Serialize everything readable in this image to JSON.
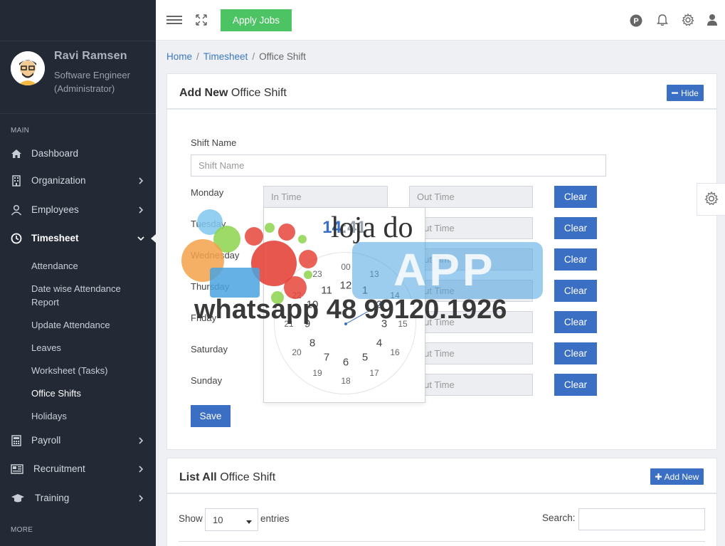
{
  "topbar": {
    "apply_label": "Apply Jobs",
    "icons": [
      "menu-icon",
      "fullscreen-icon",
      "p-badge-icon",
      "bell-icon",
      "gear-icon",
      "user-icon"
    ]
  },
  "sidebar": {
    "user": {
      "name": "Ravi Ramsen",
      "role_line1": "Software Engineer",
      "role_line2": "(Administrator)"
    },
    "main_label": "MAIN",
    "more_label": "MORE",
    "items": [
      {
        "label": "Dashboard",
        "icon": "home-icon"
      },
      {
        "label": "Organization",
        "icon": "building-icon"
      },
      {
        "label": "Employees",
        "icon": "user-icon"
      },
      {
        "label": "Timesheet",
        "icon": "clock-icon"
      },
      {
        "label": "Payroll",
        "icon": "calculator-icon"
      },
      {
        "label": "Recruitment",
        "icon": "newspaper-icon"
      },
      {
        "label": "Training",
        "icon": "graduation-cap-icon"
      }
    ],
    "timesheet_sub": [
      "Attendance",
      "Date wise Attendance",
      "Report",
      "Update Attendance",
      "Leaves",
      "Worksheet (Tasks)",
      "Office Shifts",
      "Holidays"
    ]
  },
  "breadcrumb": {
    "home": "Home",
    "section": "Timesheet",
    "current": "Office Shift"
  },
  "form_card": {
    "title_bold": "Add New",
    "title_rest": "Office Shift",
    "hide_label": "Hide",
    "shift_name_label": "Shift Name",
    "shift_name_placeholder": "Shift Name",
    "in_placeholder": "In Time",
    "out_placeholder": "Out Time",
    "clear_label": "Clear",
    "days": [
      "Monday",
      "Tuesday",
      "Wednesday",
      "Thursday",
      "Friday",
      "Saturday",
      "Sunday"
    ],
    "save_label": "Save"
  },
  "clock_picker": {
    "hour": "14",
    "separator": ":",
    "minute": "41"
  },
  "watermark": {
    "brand": "loja do",
    "app": "APP",
    "contact": "whatsapp 48 99120.1926"
  },
  "list_card": {
    "title_bold": "List All",
    "title_rest": "Office Shift",
    "add_label": "Add New",
    "show_label": "Show",
    "entries_value": "10",
    "entries_label": "entries",
    "search_label": "Search:"
  },
  "colors": {
    "sidebar": "#232a36",
    "primary": "#3a6fc4",
    "success": "#4cc464"
  }
}
